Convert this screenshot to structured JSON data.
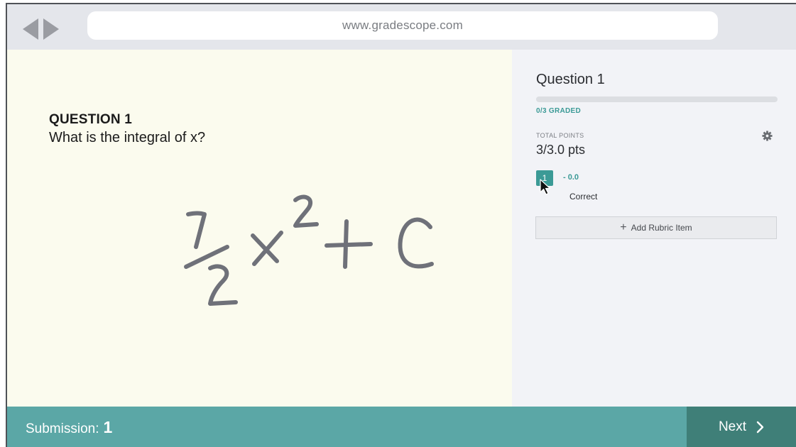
{
  "browser": {
    "url": "www.gradescope.com",
    "nav_icons": [
      "back-arrow-icon",
      "forward-arrow-icon"
    ]
  },
  "question": {
    "heading": "QUESTION 1",
    "prompt": "What is the integral of x?"
  },
  "answer": {
    "fraction_numerator": "1",
    "fraction_denominator": "2",
    "variable": "x",
    "exponent": "2",
    "operator": "+",
    "constant": "C"
  },
  "sidebar": {
    "title": "Question 1",
    "graded_text": "0/3 GRADED",
    "graded_fraction": 0,
    "total_points_label": "TOTAL POINTS",
    "total_points_value": "3/3.0 pts",
    "settings_icon": "gear-icon",
    "rubric_items": [
      {
        "key": "1",
        "delta": "- 0.0",
        "description": "Correct"
      }
    ],
    "add_rubric_label": "Add Rubric Item"
  },
  "footer": {
    "submission_label": "Submission:",
    "submission_number": "1",
    "next_label": "Next"
  },
  "colors": {
    "accent": "#3b9a96",
    "footer_bg": "#5ba7a6",
    "next_bg": "#3f7f78",
    "paper_bg": "#fbfbee",
    "ink": "#6f7179"
  }
}
